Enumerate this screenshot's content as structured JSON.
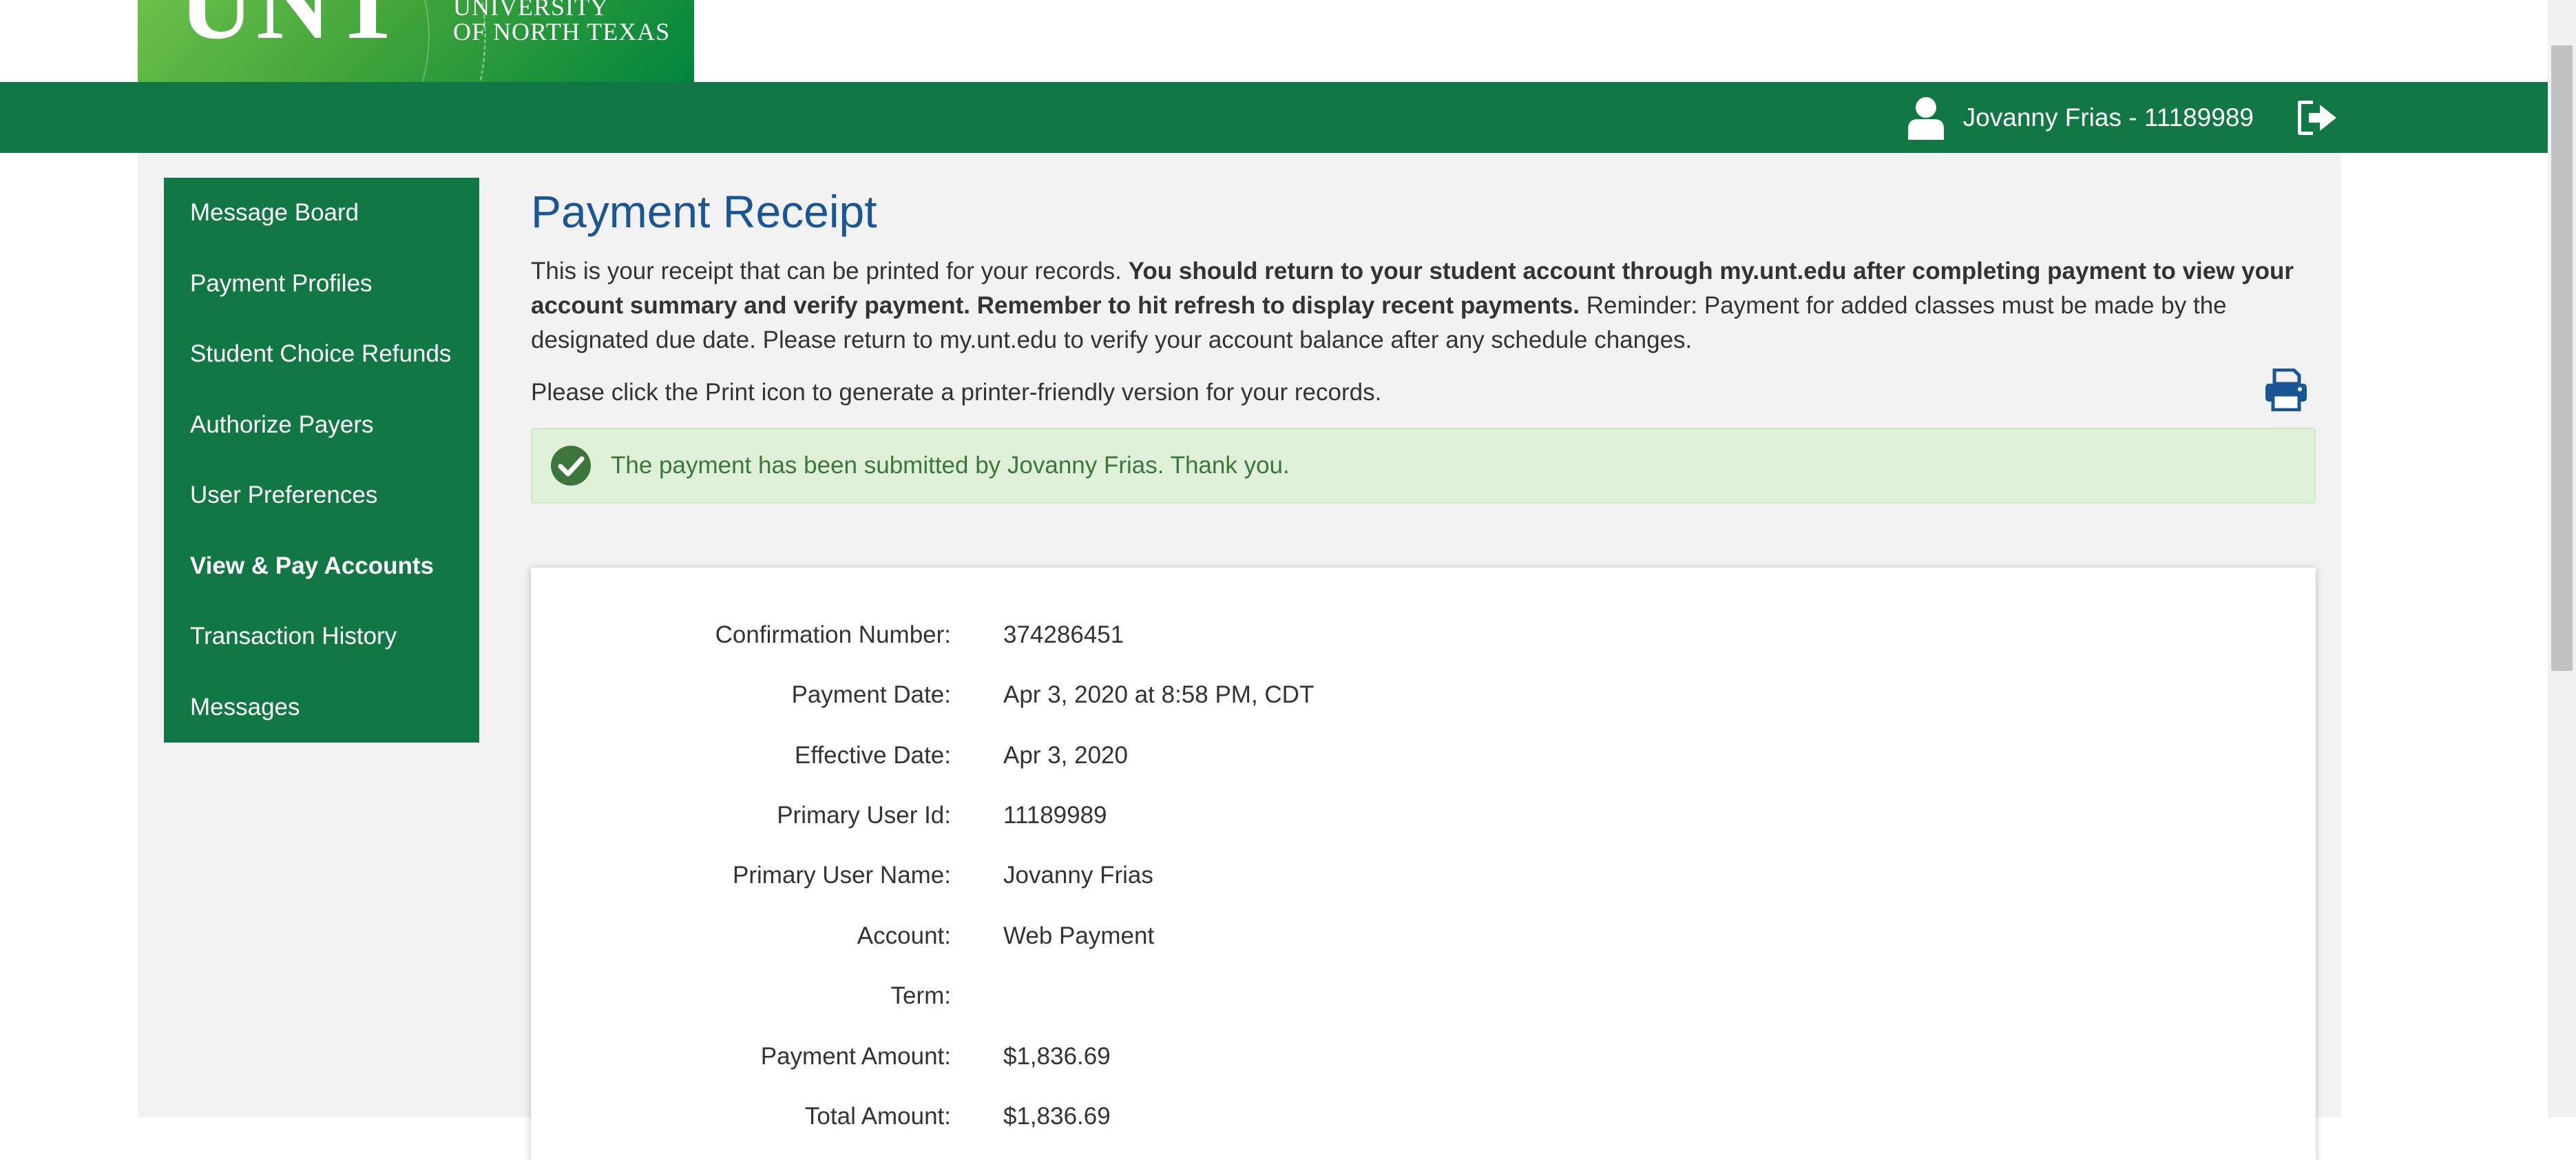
{
  "logo": {
    "big_text": "UNT",
    "line1": "UNIVERSITY",
    "line2": "OF NORTH TEXAS"
  },
  "header": {
    "user_label": "Jovanny Frias - 11189989",
    "user_icon": "user-icon",
    "logout_icon": "sign-out-icon",
    "bar_color": "#117845"
  },
  "sidebar": {
    "items": [
      {
        "label": "Message Board"
      },
      {
        "label": "Payment Profiles"
      },
      {
        "label": "Student Choice Refunds"
      },
      {
        "label": "Authorize Payers"
      },
      {
        "label": "User Preferences"
      },
      {
        "label": "View & Pay Accounts",
        "active": true
      },
      {
        "label": "Transaction History"
      },
      {
        "label": "Messages"
      }
    ]
  },
  "main": {
    "title": "Payment Receipt",
    "intro_plain": "This is your receipt that can be printed for your records. ",
    "intro_bold": "You should return to your student account through my.unt.edu after completing payment to view your account summary and verify payment. Remember to hit refresh to display recent payments.",
    "intro_reminder": " Reminder: Payment for added classes must be made by the designated due date. Please return to my.unt.edu to verify your account balance after any schedule changes.",
    "print_instruction": "Please click the Print icon to generate a printer-friendly version for your records.",
    "print_icon": "print-icon",
    "alert_text": "The payment has been submitted by Jovanny Frias. Thank you.",
    "alert_icon": "check-circle-icon",
    "title_color": "#1a5596"
  },
  "receipt": {
    "rows": [
      {
        "label": "Confirmation Number:",
        "value": "374286451"
      },
      {
        "label": "Payment Date:",
        "value": "Apr 3, 2020 at 8:58 PM, CDT"
      },
      {
        "label": "Effective Date:",
        "value": "Apr 3, 2020"
      },
      {
        "label": "Primary User Id:",
        "value": "11189989"
      },
      {
        "label": "Primary User Name:",
        "value": "Jovanny Frias"
      },
      {
        "label": "Account:",
        "value": "Web Payment"
      },
      {
        "label": "Term:",
        "value": ""
      },
      {
        "label": "Payment Amount:",
        "value": "$1,836.69"
      },
      {
        "label": "Total Amount:",
        "value": "$1,836.69"
      }
    ]
  }
}
